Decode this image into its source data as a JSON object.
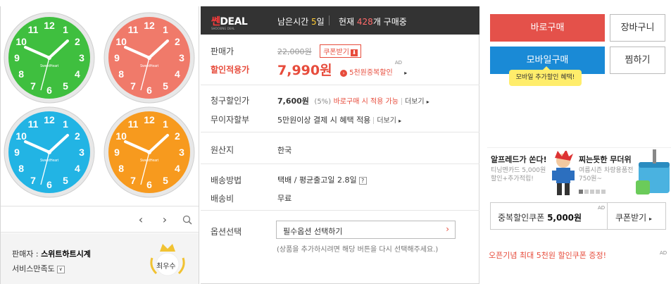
{
  "gallery": {
    "colors": [
      "#3fbf3f",
      "#f07a6a",
      "#22b4e4",
      "#f79a1e"
    ],
    "clock_numbers": [
      "12",
      "1",
      "2",
      "3",
      "4",
      "5",
      "6",
      "7",
      "8",
      "9",
      "10",
      "11"
    ],
    "brand": "SweetHeart",
    "prev_icon": "‹",
    "next_icon": "›",
    "zoom_icon": "search-icon"
  },
  "seller": {
    "label": "판매자 : ",
    "name": "스위트하트시계",
    "satisfaction_label": "서비스만족도",
    "dropdown_icon": "∨",
    "badge_text": "최우수"
  },
  "deal": {
    "logo_hot": "쎈",
    "logo_deal": "DEAL",
    "logo_sub": "SHOCKING DEAL",
    "remain_prefix": "남은시간 ",
    "remain_num": "5",
    "remain_suffix": "일",
    "now_prefix": "현재 ",
    "now_num": "428",
    "now_suffix": "개 구매중"
  },
  "price": {
    "sale_price_label": "판매가",
    "original_price": "22,000원",
    "coupon_tag": "쿠폰받기",
    "discount_label": "할인적용가",
    "final_price": "7,990원",
    "dup_discount": "5천원중복할인",
    "ad": "AD"
  },
  "details": {
    "billing_label": "청구할인가",
    "billing_price": "7,600원",
    "billing_pct": "(5%)",
    "billing_note": "바로구매 시 적용 가능",
    "more": "더보기",
    "installment_label": "무이자할부",
    "installment_value": "5만원이상 결제 시 혜택 적용",
    "origin_label": "원산지",
    "origin_value": "한국",
    "shipping_label": "배송방법",
    "shipping_value": "택배 / 평균출고일 2.8일",
    "shipping_q": "?",
    "fee_label": "배송비",
    "fee_value": "무료",
    "option_label": "옵션선택",
    "option_placeholder": "필수옵션 선택하기",
    "option_hint": "(상품을 추가하시려면 해당 버튼을 다시 선택해주세요.)"
  },
  "actions": {
    "buy_now": "바로구매",
    "cart": "장바구니",
    "mobile_buy": "모바일구매",
    "wishlist": "찜하기",
    "mobile_tip": "모바일 추가할인 혜택!"
  },
  "ads": {
    "ad1_title": "알프레드가 쏜다!",
    "ad1_sub": "티닝멘카드 5,000원 할인+추가적립!",
    "ad2_title": "찌는듯한 무더위",
    "ad2_sub": "여름시즌 차량용품전 750원~"
  },
  "coupon": {
    "label": "중복할인쿠폰",
    "amount": "5,000원",
    "ad": "AD",
    "button": "쿠폰받기"
  },
  "promo": {
    "text": "오픈기념 최대 5천원 할인쿠폰 증정!",
    "ad": "AD"
  }
}
